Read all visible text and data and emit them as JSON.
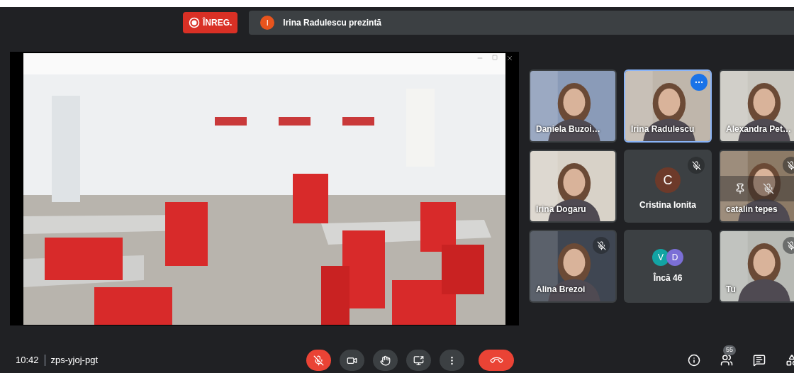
{
  "recording": {
    "label": "ÎNREG.",
    "on": true
  },
  "presenter_banner": {
    "initial": "I",
    "text": "Irina Radulescu prezintă"
  },
  "tiles": [
    {
      "kind": "video",
      "name": "Daniela Buzoi…",
      "speaking": false,
      "muted": false,
      "menu_open": false,
      "hovered": false
    },
    {
      "kind": "video",
      "name": "Irina Radulescu",
      "speaking": true,
      "muted": false,
      "menu_open": true,
      "hovered": false
    },
    {
      "kind": "video",
      "name": "Alexandra Pet…",
      "speaking": false,
      "muted": false,
      "menu_open": false,
      "hovered": false
    },
    {
      "kind": "video",
      "name": "Irina Dogaru",
      "speaking": false,
      "muted": false,
      "menu_open": false,
      "hovered": false
    },
    {
      "kind": "avatar",
      "name": "Cristina Ionita",
      "initial": "C",
      "color": "#6d3a2a",
      "speaking": false,
      "muted": true,
      "menu_open": false,
      "hovered": false
    },
    {
      "kind": "video",
      "name": "catalin tepes",
      "speaking": false,
      "muted": true,
      "menu_open": false,
      "hovered": true
    },
    {
      "kind": "video",
      "name": "Alina Brezoi",
      "speaking": false,
      "muted": true,
      "menu_open": false,
      "hovered": false
    },
    {
      "kind": "more",
      "label": "Încă 46",
      "avatars": [
        {
          "initial": "V",
          "color": "#12a3a3"
        },
        {
          "initial": "D",
          "color": "#7b6fd6"
        }
      ],
      "speaking": false,
      "muted": false,
      "menu_open": false,
      "hovered": false
    },
    {
      "kind": "video",
      "name": "Tu",
      "speaking": false,
      "muted": true,
      "menu_open": false,
      "hovered": false
    }
  ],
  "bottom_bar": {
    "time": "10:42",
    "meeting_code": "zps-yjoj-pgt",
    "controls": [
      {
        "kind": "mic",
        "off": true
      },
      {
        "kind": "camera",
        "off": false
      },
      {
        "kind": "hand",
        "off": false
      },
      {
        "kind": "present",
        "off": false
      },
      {
        "kind": "more",
        "off": false
      },
      {
        "kind": "hangup"
      }
    ],
    "people_count": "55"
  }
}
